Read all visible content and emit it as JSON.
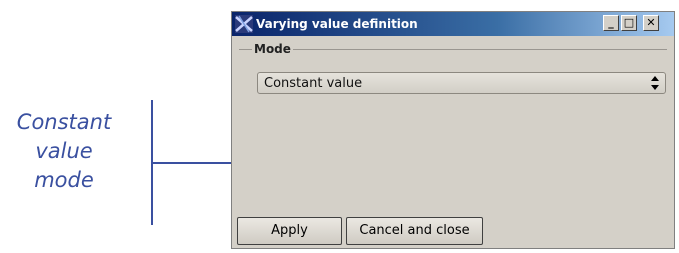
{
  "annotation": {
    "lines": [
      "Constant",
      "value",
      "mode"
    ]
  },
  "window": {
    "title": "Varying value definition",
    "controls": {
      "minimize": "_",
      "maximize": "□",
      "close": "✕"
    }
  },
  "mode_group": {
    "label": "Mode",
    "select_value": "Constant value"
  },
  "buttons": {
    "apply": "Apply",
    "cancel_close": "Cancel and close"
  },
  "colors": {
    "annotation": "#3a50a0",
    "titlebar_start": "#0a246a",
    "titlebar_end": "#a6caf0",
    "window_bg": "#d4d0c8"
  }
}
